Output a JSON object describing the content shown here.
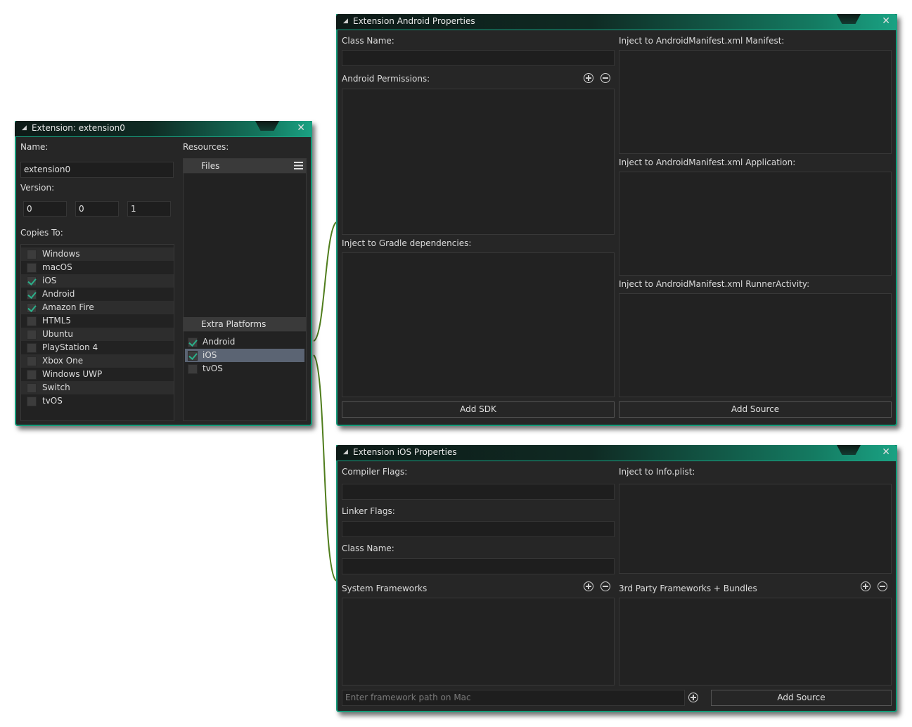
{
  "ext_window": {
    "title": "Extension: extension0",
    "name_label": "Name:",
    "name_value": "extension0",
    "version_label": "Version:",
    "version": [
      "0",
      "0",
      "1"
    ],
    "copies_label": "Copies To:",
    "platforms": [
      {
        "label": "Windows",
        "checked": false
      },
      {
        "label": "macOS",
        "checked": false
      },
      {
        "label": "iOS",
        "checked": true
      },
      {
        "label": "Android",
        "checked": true
      },
      {
        "label": "Amazon Fire",
        "checked": true
      },
      {
        "label": "HTML5",
        "checked": false
      },
      {
        "label": "Ubuntu",
        "checked": false
      },
      {
        "label": "PlayStation 4",
        "checked": false
      },
      {
        "label": "Xbox One",
        "checked": false
      },
      {
        "label": "Windows UWP",
        "checked": false
      },
      {
        "label": "Switch",
        "checked": false
      },
      {
        "label": "tvOS",
        "checked": false
      }
    ],
    "resources_label": "Resources:",
    "files_header": "Files",
    "extra_header": "Extra Platforms",
    "extra_platforms": [
      {
        "label": "Android",
        "checked": true
      },
      {
        "label": "iOS",
        "checked": true,
        "selected": true
      },
      {
        "label": "tvOS",
        "checked": false
      }
    ]
  },
  "android_window": {
    "title": "Extension Android Properties",
    "class_name_label": "Class Name:",
    "permissions_label": "Android Permissions:",
    "gradle_label": "Inject to Gradle dependencies:",
    "manifest_label": "Inject to AndroidManifest.xml Manifest:",
    "application_label": "Inject to AndroidManifest.xml Application:",
    "runner_label": "Inject to AndroidManifest.xml RunnerActivity:",
    "add_sdk": "Add SDK",
    "add_source": "Add Source"
  },
  "ios_window": {
    "title": "Extension iOS Properties",
    "compiler_label": "Compiler Flags:",
    "linker_label": "Linker Flags:",
    "class_name_label": "Class Name:",
    "info_plist_label": "Inject to Info.plist:",
    "system_frameworks_label": "System Frameworks",
    "third_party_label": "3rd Party Frameworks + Bundles",
    "framework_path_placeholder": "Enter framework path on Mac",
    "add_source": "Add Source"
  },
  "colors": {
    "accent": "#149c7a",
    "panel_bg": "#262626",
    "connector": "#4a7a1a"
  }
}
